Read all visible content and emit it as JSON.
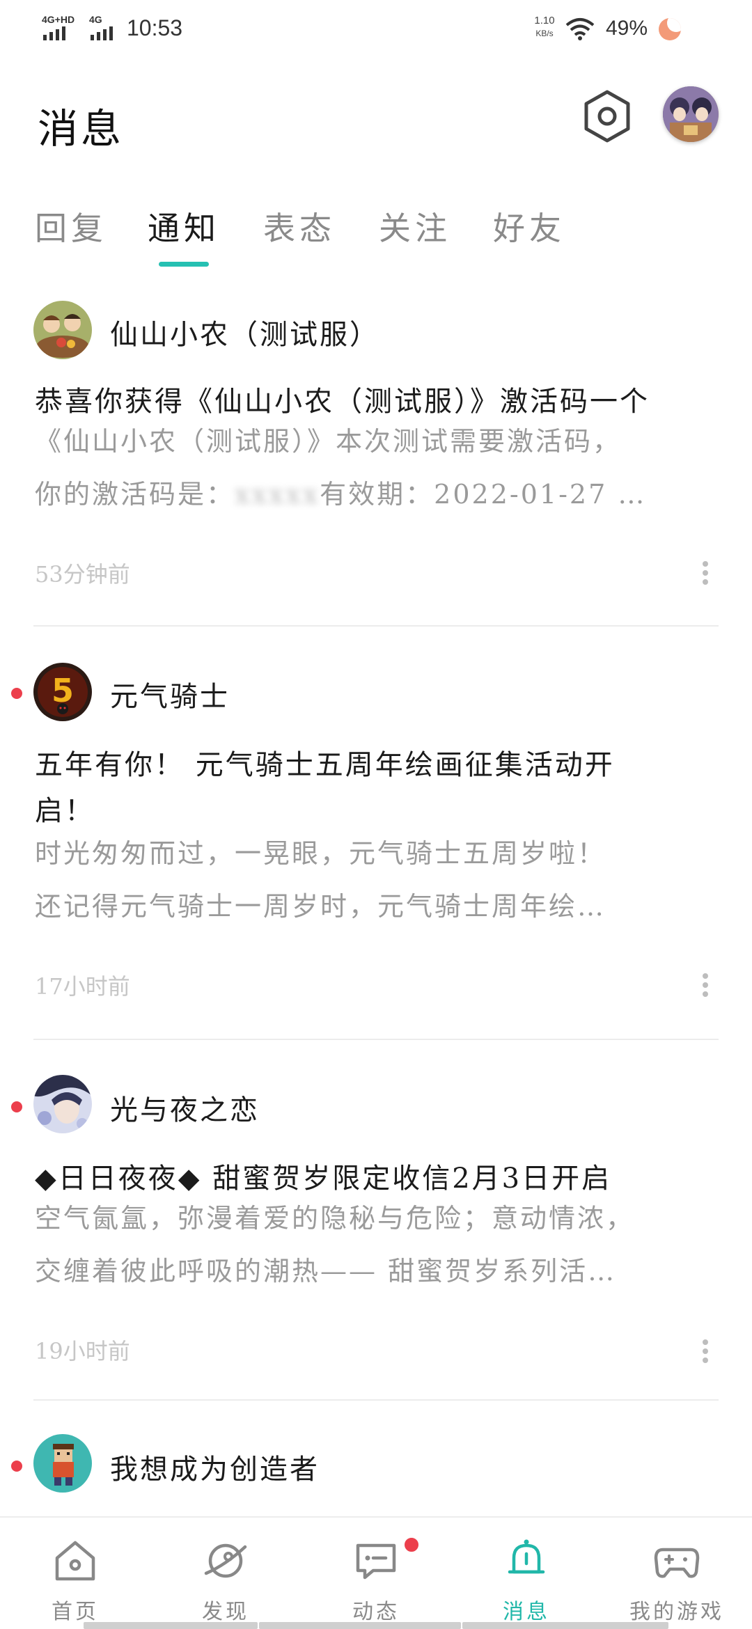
{
  "status_bar": {
    "network1": "4G+HD",
    "network2": "4G",
    "time": "10:53",
    "speed_value": "1.10",
    "speed_unit": "KB/s",
    "battery": "49%"
  },
  "header": {
    "title": "消息"
  },
  "tabs": [
    {
      "label": "回复"
    },
    {
      "label": "通知"
    },
    {
      "label": "表态"
    },
    {
      "label": "关注"
    },
    {
      "label": "好友"
    }
  ],
  "active_tab": "通知",
  "accent_color": "#26c0b2",
  "unread_dot_color": "#ec3f4c",
  "messages": [
    {
      "name": "仙山小农（测试服）",
      "title": "恭喜你获得《仙山小农（测试服）》激活码一个",
      "body_line1": "《仙山小农（测试服）》本次测试需要激活码，",
      "body_line2": "你的激活码是：",
      "body_line2b": "有效期：2022-01-27 …",
      "time": "53分钟前",
      "unread": false
    },
    {
      "name": "元气骑士",
      "title_line1": "五年有你！ 元气骑士五周年绘画征集活动开",
      "title_line2": "启！",
      "body_line1": "时光匆匆而过，一晃眼，元气骑士五周岁啦！",
      "body_line2": "还记得元气骑士一周岁时，元气骑士周年绘…",
      "time": "17小时前",
      "unread": true
    },
    {
      "name": "光与夜之恋",
      "title": "◆日日夜夜◆ 甜蜜贺岁限定收信2月3日开启",
      "body_line1": "空气氤氲，弥漫着爱的隐秘与危险；意动情浓，",
      "body_line2": "交缠着彼此呼吸的潮热—— 甜蜜贺岁系列活…",
      "time": "19小时前",
      "unread": true
    },
    {
      "name": "我想成为创造者",
      "unread": true
    }
  ],
  "bottom_nav": [
    {
      "label": "首页",
      "icon": "home-icon"
    },
    {
      "label": "发现",
      "icon": "planet-icon"
    },
    {
      "label": "动态",
      "icon": "chat-icon"
    },
    {
      "label": "消息",
      "icon": "bell-icon"
    },
    {
      "label": "我的游戏",
      "icon": "gamepad-icon"
    }
  ],
  "active_nav": "消息"
}
